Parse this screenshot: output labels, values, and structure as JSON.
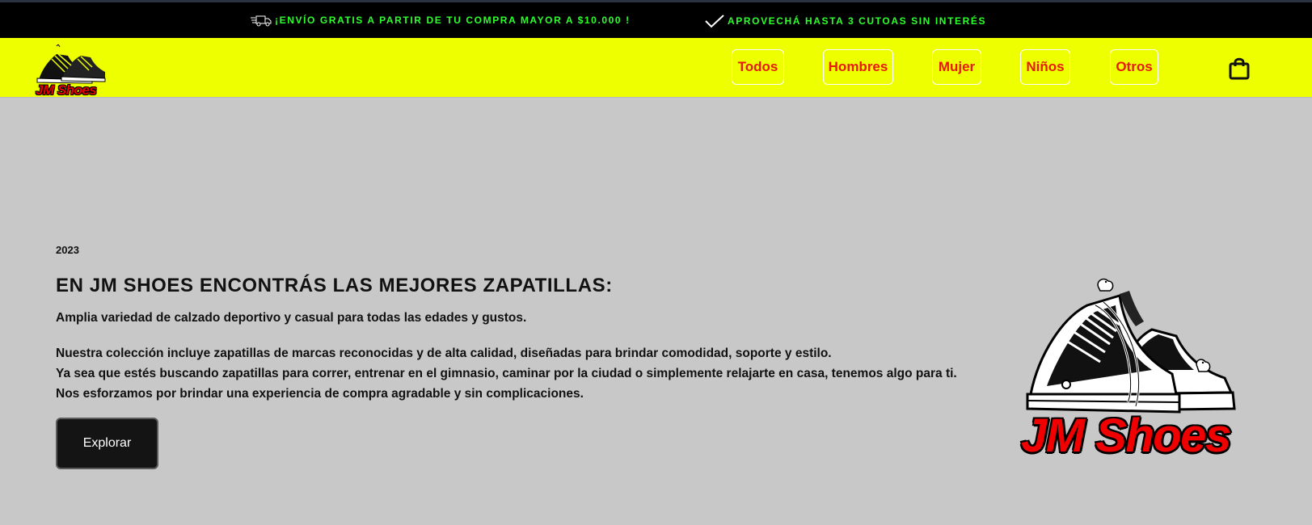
{
  "topbar": {
    "promo_shipping": "¡ENVÍO GRATIS A PARTIR DE TU COMPRA MAYOR A $10.000 !",
    "promo_installments": "APROVECHÁ HASTA 3 CUTOAS SIN INTERÉS",
    "promo_color": "#2cff2c",
    "shipping_icon": "delivery-truck-icon",
    "check_icon": "checkmark-icon"
  },
  "navbar": {
    "background": "#eeff00",
    "logo_text": "JM Shoes",
    "items": [
      {
        "label": "Todos"
      },
      {
        "label": "Hombres"
      },
      {
        "label": "Mujer"
      },
      {
        "label": "Niños"
      },
      {
        "label": "Otros"
      }
    ],
    "item_color": "#e8190f",
    "cart_icon": "shopping-bag-icon"
  },
  "hero": {
    "year": "2023",
    "headline": "EN JM SHOES ENCONTRÁS LAS MEJORES ZAPATILLAS:",
    "lead": "Amplia variedad de calzado deportivo y casual para todas las edades y gustos.",
    "lines": [
      "Nuestra colección incluye zapatillas de marcas reconocidas y de alta calidad, diseñadas para brindar comodidad, soporte y estilo.",
      "Ya sea que estés buscando zapatillas para correr, entrenar en el gimnasio, caminar por la ciudad o simplemente relajarte en casa, tenemos algo para ti.",
      "Nos esforzamos por brindar una experiencia de compra agradable y sin complicaciones."
    ],
    "button_label": "Explorar",
    "logo_text": "JM Shoes"
  }
}
